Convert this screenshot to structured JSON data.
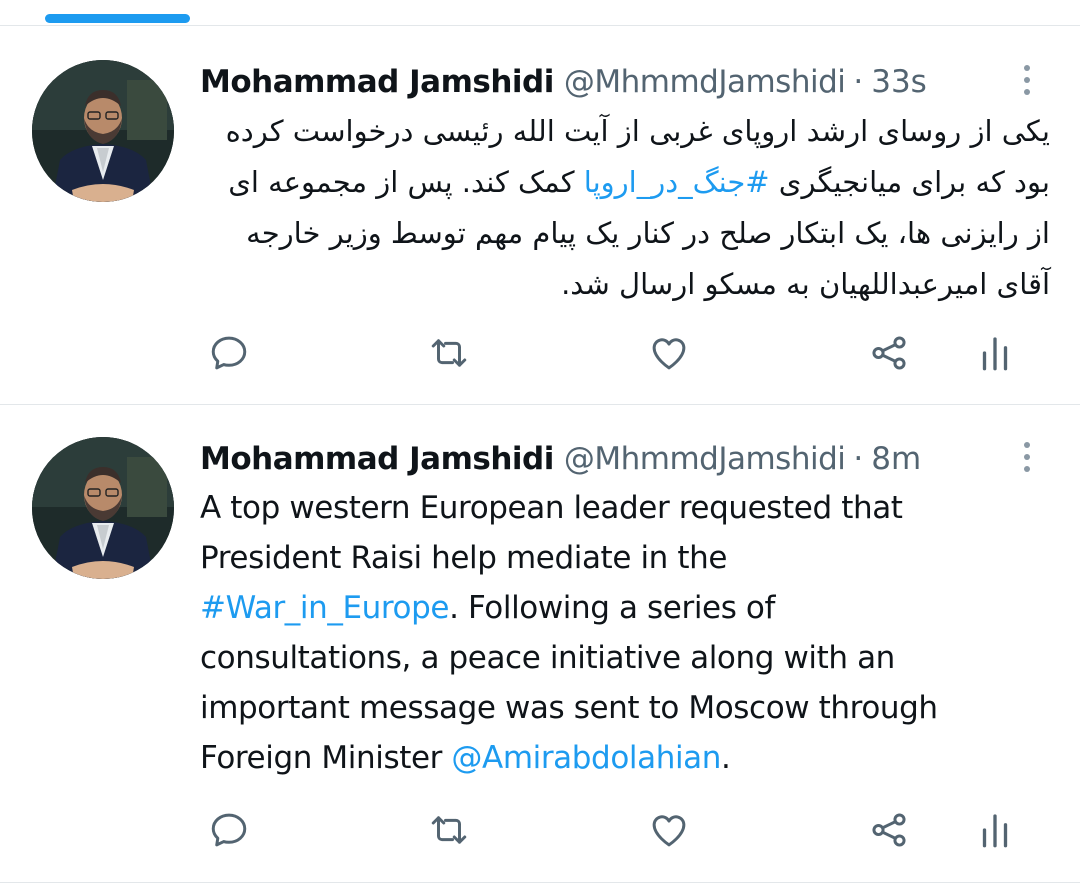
{
  "colors": {
    "accent": "#1d9bf0",
    "icon": "#536471",
    "divider": "#e3e7ea",
    "indicator": "#1d9bf0"
  },
  "tweets": [
    {
      "name": "Mohammad Jamshidi",
      "handle": "@MhmmdJamshidi",
      "separator": "·",
      "time": "33s",
      "text_before": "یکی از روسای ارشد اروپای غربی از آیت الله رئیسی درخواست کرده بود که برای میانجیگری ",
      "hashtag": "#جنگ_در_اروپا",
      "text_after": " کمک کند. پس از مجموعه ای از رایزنی ها، یک ابتکار صلح در کنار یک پیام مهم توسط وزیر خارجه آقای امیرعبداللهیان به مسکو ارسال شد.",
      "icons": [
        "reply-icon",
        "retweet-icon",
        "like-icon",
        "share-icon",
        "analytics-icon",
        "more-icon"
      ]
    },
    {
      "name": "Mohammad Jamshidi",
      "handle": "@MhmmdJamshidi",
      "separator": "·",
      "time": "8m",
      "line1": "A top western European leader requested that",
      "line2": "President Raisi help mediate in the",
      "hashtag": "#War_in_Europe",
      "line3_rest": ". Following a series of",
      "line4": "consultations, a peace initiative along with an",
      "line5": "important message was sent to Moscow through",
      "line6_before": "Foreign Minister ",
      "mention": "@Amirabdolahian",
      "line6_after": ".",
      "icons": [
        "reply-icon",
        "retweet-icon",
        "like-icon",
        "share-icon",
        "analytics-icon",
        "more-icon"
      ]
    }
  ]
}
